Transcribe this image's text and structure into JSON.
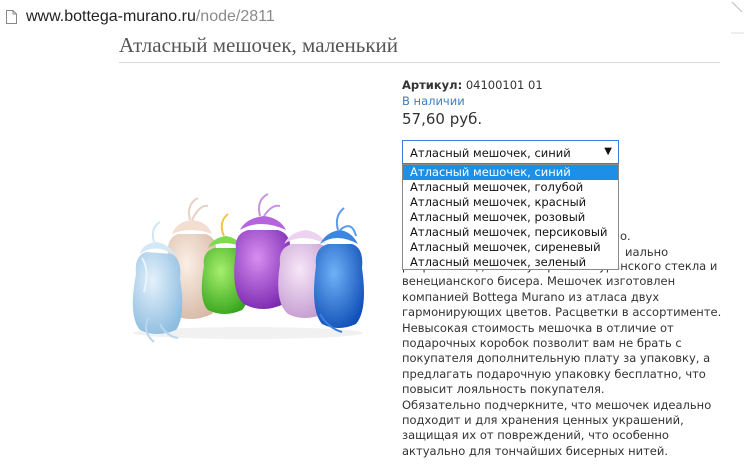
{
  "browser": {
    "url_domain": "www.bottega-murano.ru",
    "url_path": "/node/2811"
  },
  "product": {
    "title": "Атласный мешочек, маленький",
    "sku_label": "Артикул:",
    "sku_value": "04100101 01",
    "stock": "В наличии",
    "price": "57,60 руб.",
    "selected_variant": "Атласный мешочек, синий",
    "variants": [
      "Атласный мешочек, синий",
      "Атласный мешочек, голубой",
      "Атласный мешочек, красный",
      "Атласный мешочек, розовый",
      "Атласный мешочек, персиковый",
      "Атласный мешочек, сиреневый",
      "Атласный мешочек, зеленый"
    ],
    "desc_fragment_1": "о.",
    "desc_fragment_2": "иально",
    "desc_lines": [
      "разработан для бижутерии из муранского стекла и",
      "венецианского бисера. Мешочек изготовлен",
      "компанией Bottega Murano из атласа двух",
      "гармонирующих цветов. Расцветки в ассортименте.",
      "Невысокая стоимость мешочка в отличие от",
      "подарочных коробок позволит вам не брать с",
      "покупателя дополнительную плату за упаковку, а",
      "предлагать подарочную упаковку бесплатно, что",
      "повысит лояльность покупателя.",
      "Обязательно подчеркните, что мешочек идеально",
      "подходит и для хранения ценных украшений,",
      "защищая их от повреждений, что особенно",
      "актуально для тончайших бисерных нитей."
    ]
  },
  "colors": {
    "accent_blue": "#3a7fc1",
    "highlight": "#1e8fe6"
  }
}
